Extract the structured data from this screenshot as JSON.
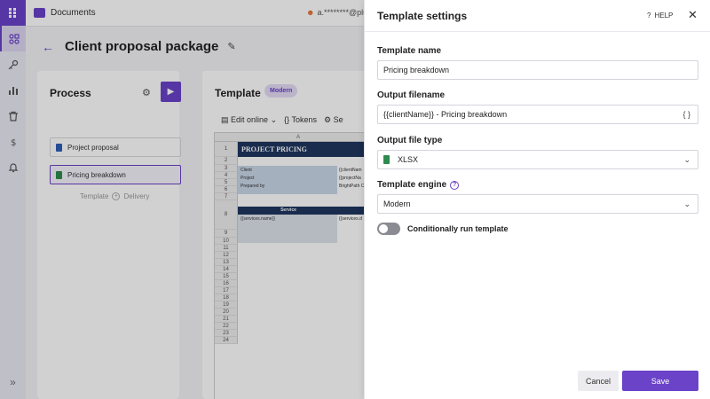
{
  "app": {
    "brand_label": "Documents",
    "user_label": "a.********@plu",
    "page_title": "Client proposal package"
  },
  "process": {
    "heading": "Process",
    "items": [
      {
        "label": "Project proposal",
        "type": "word"
      },
      {
        "label": "Pricing breakdown",
        "type": "excel"
      }
    ],
    "caption_left": "Template",
    "caption_right": "Delivery"
  },
  "template_card": {
    "heading": "Template",
    "badge": "Modern",
    "toolbar": {
      "edit_online": "Edit online",
      "tokens": "Tokens",
      "settings_short": "Se"
    },
    "sheet": {
      "col_header": "A",
      "title": "PROJECT PRICING",
      "client_label": "Client",
      "project_label": "Project",
      "prepared_label": "Prepared by",
      "client_token": "{{clientNam",
      "project_token": "{{projectNa",
      "prepared_value": "BrightPath C",
      "service_header": "Service",
      "service_token": "{{services.name}}",
      "service_token2": "{{services.d",
      "row_numbers": [
        "1",
        "2",
        "3",
        "4",
        "5",
        "6",
        "7",
        "8",
        "9",
        "10",
        "11",
        "12",
        "13",
        "14",
        "15",
        "16",
        "17",
        "18",
        "19",
        "20",
        "21",
        "22",
        "23",
        "24"
      ]
    }
  },
  "panel": {
    "title": "Template settings",
    "help_label": "HELP",
    "template_name_label": "Template name",
    "template_name_value": "Pricing breakdown",
    "output_filename_label": "Output filename",
    "output_filename_value": "{{clientName}} - Pricing breakdown",
    "output_file_type_label": "Output file type",
    "output_file_type_value": "XLSX",
    "template_engine_label": "Template engine",
    "template_engine_value": "Modern",
    "conditional_label": "Conditionally run template",
    "conditional_enabled": false,
    "cancel_label": "Cancel",
    "save_label": "Save"
  },
  "colors": {
    "accent": "#6a43c8",
    "excel_green": "#2e8b4e",
    "word_blue": "#2b5fb8",
    "sheet_title_bg": "#1f3660"
  }
}
